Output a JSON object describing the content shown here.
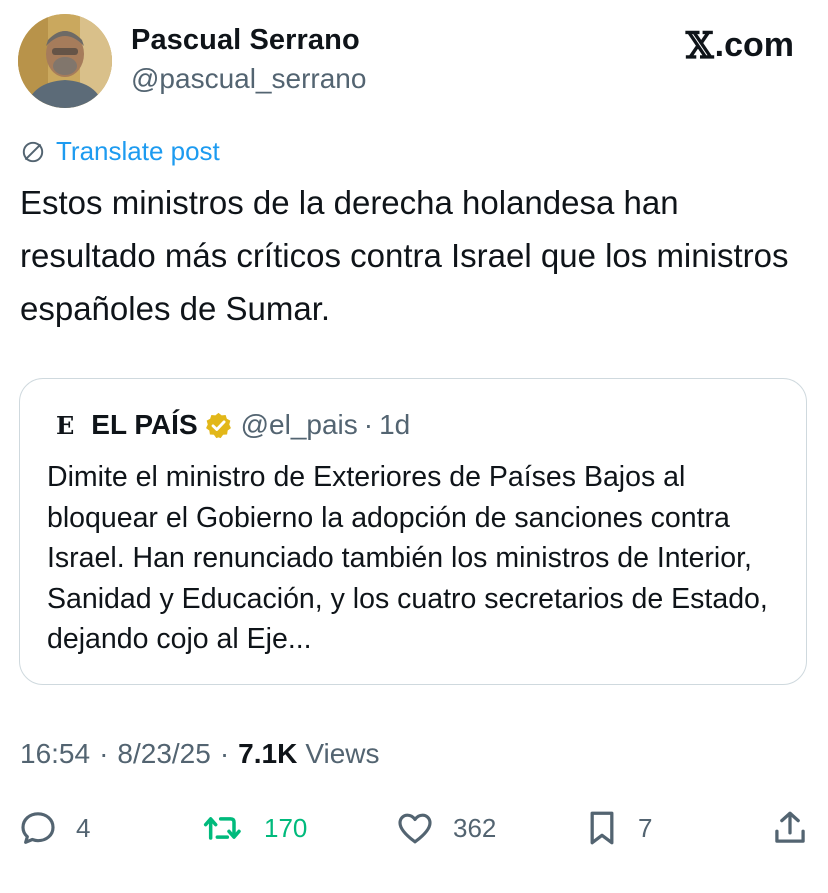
{
  "author": {
    "display_name": "Pascual Serrano",
    "handle": "@pascual_serrano",
    "avatar_icon": "profile-photo"
  },
  "brand": {
    "glyph": "𝕏",
    "suffix": ".com"
  },
  "translate": {
    "icon": "globe-icon",
    "label": "Translate post",
    "color": "#1d9bf0"
  },
  "post": {
    "text": "Estos ministros de la derecha holandesa han resultado más críticos contra Israel que los ministros españoles de Sumar."
  },
  "quoted_post": {
    "logo": "E",
    "name": "EL PAÍS",
    "verified_badge": "gold-verified-badge-icon",
    "handle": "@el_pais",
    "separator": "·",
    "time": "1d",
    "text": "Dimite el ministro de Exteriores de Países Bajos al bloquear el Gobierno la adopción de sanciones contra Israel. Han renunciado también los ministros de Interior, Sanidad y Educación, y los cuatro secretarios de Estado, dejando cojo al Eje..."
  },
  "meta": {
    "time": "16:54",
    "sep1": "·",
    "date": "8/23/25",
    "sep2": "·",
    "views_count": "7.1K",
    "views_label": "Views"
  },
  "actions": {
    "replies": {
      "icon": "reply-icon",
      "count": "4"
    },
    "reposts": {
      "icon": "repost-icon",
      "count": "170",
      "color": "#00ba7c"
    },
    "likes": {
      "icon": "heart-icon",
      "count": "362"
    },
    "bookmarks": {
      "icon": "bookmark-icon",
      "count": "7"
    },
    "share": {
      "icon": "share-icon"
    }
  }
}
